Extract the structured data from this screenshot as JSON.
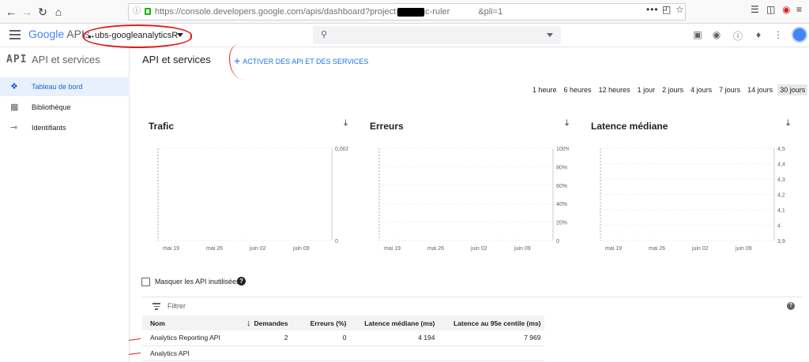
{
  "browser": {
    "url": "https://console.developers.google.com/apis/dashboard?project=organic-ruler",
    "url_suffix": "&pli=1"
  },
  "header": {
    "logo_google": "Google",
    "logo_apis": "APIs",
    "project_name": "ubs-googleanalyticsR",
    "search_placeholder": ""
  },
  "sidebar": {
    "badge": "API",
    "title": "API et services",
    "items": [
      {
        "label": "Tableau de bord",
        "icon": "dashboard-icon"
      },
      {
        "label": "Bibliothèque",
        "icon": "library-icon"
      },
      {
        "label": "Identifiants",
        "icon": "key-icon"
      }
    ]
  },
  "main": {
    "title": "API et services",
    "enable_label": "ACTIVER DES API ET DES SERVICES",
    "time_ranges": [
      "1 heure",
      "6 heures",
      "12 heures",
      "1 jour",
      "2 jours",
      "4 jours",
      "7 jours",
      "14 jours",
      "30 jours"
    ],
    "selected_range": "30 jours",
    "hide_unused_label": "Masquer les API inutilisées",
    "filter_placeholder": "Filtrer",
    "table": {
      "columns": [
        "Nom",
        "Demandes",
        "Erreurs (%)",
        "Latence médiane (ms)",
        "Latence au 95e centile (ms)"
      ],
      "rows": [
        {
          "name": "Analytics Reporting API",
          "requests": "2",
          "errors": "0",
          "median": "4 194",
          "p95": "7 969"
        },
        {
          "name": "Analytics API",
          "requests": "",
          "errors": "",
          "median": "",
          "p95": ""
        }
      ]
    }
  },
  "chart_data": [
    {
      "type": "scatter",
      "title": "Trafic",
      "xticks": [
        "mai 19",
        "mai 26",
        "juin 02",
        "juin 09"
      ],
      "yticks": [
        "0,001/s",
        "0"
      ],
      "ylim": [
        0,
        0.001
      ]
    },
    {
      "type": "scatter",
      "title": "Erreurs",
      "xticks": [
        "mai 19",
        "mai 26",
        "juin 02",
        "juin 09"
      ],
      "yticks": [
        "100%",
        "80%",
        "60%",
        "40%",
        "20%",
        "0"
      ],
      "ylim": [
        0,
        100
      ]
    },
    {
      "type": "scatter",
      "title": "Latence médiane",
      "xticks": [
        "mai 19",
        "mai 26",
        "juin 02",
        "juin 09"
      ],
      "yticks": [
        "4,5",
        "4,4",
        "4,3",
        "4,2",
        "4,1",
        "4",
        "3,9"
      ],
      "ylim": [
        3.9,
        4.5
      ]
    }
  ],
  "colors": {
    "accent": "#1a73e8",
    "annotation": "#e21b1b",
    "selected_nav": "#e8f0fe"
  }
}
